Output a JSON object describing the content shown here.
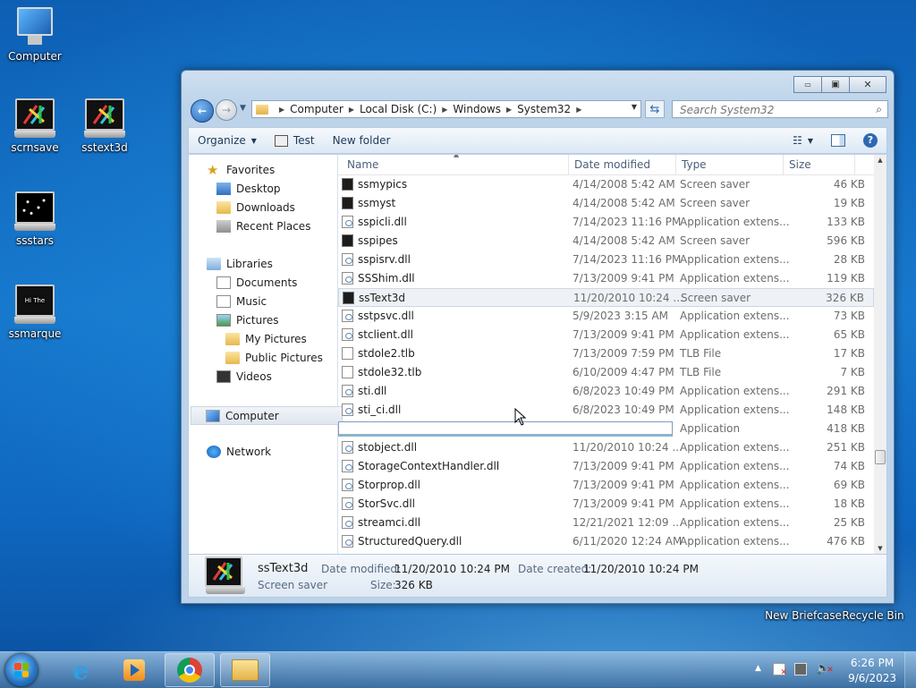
{
  "desktop": {
    "icons": [
      {
        "label": "Computer"
      },
      {
        "label": "scrnsave"
      },
      {
        "label": "sstext3d"
      },
      {
        "label": "ssstars"
      },
      {
        "label": "ssmarque"
      },
      {
        "label": "New Briefcase"
      },
      {
        "label": "Recycle Bin"
      }
    ],
    "marquee_text": "Hi The"
  },
  "window": {
    "caption_buttons": {
      "minimize": "▭",
      "maximize": "▣",
      "close": "✕"
    },
    "address": {
      "crumbs": [
        "Computer",
        "Local Disk (C:)",
        "Windows",
        "System32"
      ]
    },
    "search": {
      "placeholder": "Search System32"
    },
    "toolbar": {
      "organize": "Organize",
      "test": "Test",
      "new_folder": "New folder"
    },
    "nav_pane": {
      "favorites": "Favorites",
      "desktop": "Desktop",
      "downloads": "Downloads",
      "recent_places": "Recent Places",
      "libraries": "Libraries",
      "documents": "Documents",
      "music": "Music",
      "pictures": "Pictures",
      "my_pictures": "My Pictures",
      "public_pictures": "Public Pictures",
      "videos": "Videos",
      "computer": "Computer",
      "network": "Network"
    },
    "columns": {
      "name": "Name",
      "date": "Date modified",
      "type": "Type",
      "size": "Size"
    },
    "files": [
      {
        "name": "ssmypics",
        "date": "4/14/2008 5:42 AM",
        "type": "Screen saver",
        "size": "46 KB",
        "icon": "screensaver"
      },
      {
        "name": "ssmyst",
        "date": "4/14/2008 5:42 AM",
        "type": "Screen saver",
        "size": "19 KB",
        "icon": "screensaver"
      },
      {
        "name": "sspicli.dll",
        "date": "7/14/2023 11:16 PM",
        "type": "Application extens...",
        "size": "133 KB",
        "icon": "dll"
      },
      {
        "name": "sspipes",
        "date": "4/14/2008 5:42 AM",
        "type": "Screen saver",
        "size": "596 KB",
        "icon": "screensaver"
      },
      {
        "name": "sspisrv.dll",
        "date": "7/14/2023 11:16 PM",
        "type": "Application extens...",
        "size": "28 KB",
        "icon": "dll"
      },
      {
        "name": "SSShim.dll",
        "date": "7/13/2009 9:41 PM",
        "type": "Application extens...",
        "size": "119 KB",
        "icon": "dll"
      },
      {
        "name": "ssText3d",
        "date": "11/20/2010 10:24 ...",
        "type": "Screen saver",
        "size": "326 KB",
        "icon": "screensaver"
      },
      {
        "name": "sstpsvc.dll",
        "date": "5/9/2023 3:15 AM",
        "type": "Application extens...",
        "size": "73 KB",
        "icon": "dll"
      },
      {
        "name": "stclient.dll",
        "date": "7/13/2009 9:41 PM",
        "type": "Application extens...",
        "size": "65 KB",
        "icon": "dll"
      },
      {
        "name": "stdole2.tlb",
        "date": "7/13/2009 7:59 PM",
        "type": "TLB File",
        "size": "17 KB",
        "icon": "tlb"
      },
      {
        "name": "stdole32.tlb",
        "date": "6/10/2009 4:47 PM",
        "type": "TLB File",
        "size": "7 KB",
        "icon": "tlb"
      },
      {
        "name": "sti.dll",
        "date": "6/8/2023 10:49 PM",
        "type": "Application extens...",
        "size": "291 KB",
        "icon": "dll"
      },
      {
        "name": "sti_ci.dll",
        "date": "6/8/2023 10:49 PM",
        "type": "Application extens...",
        "size": "148 KB",
        "icon": "dll"
      },
      {
        "name": "",
        "date": "",
        "type": "Application",
        "size": "418 KB",
        "icon": "rename"
      },
      {
        "name": "stobject.dll",
        "date": "11/20/2010 10:24 ...",
        "type": "Application extens...",
        "size": "251 KB",
        "icon": "dll"
      },
      {
        "name": "StorageContextHandler.dll",
        "date": "7/13/2009 9:41 PM",
        "type": "Application extens...",
        "size": "74 KB",
        "icon": "dll"
      },
      {
        "name": "Storprop.dll",
        "date": "7/13/2009 9:41 PM",
        "type": "Application extens...",
        "size": "69 KB",
        "icon": "dll"
      },
      {
        "name": "StorSvc.dll",
        "date": "7/13/2009 9:41 PM",
        "type": "Application extens...",
        "size": "18 KB",
        "icon": "dll"
      },
      {
        "name": "streamci.dll",
        "date": "12/21/2021 12:09 ...",
        "type": "Application extens...",
        "size": "25 KB",
        "icon": "dll"
      },
      {
        "name": "StructuredQuery.dll",
        "date": "6/11/2020 12:24 AM",
        "type": "Application extens...",
        "size": "476 KB",
        "icon": "dll"
      }
    ],
    "details": {
      "name": "ssText3d",
      "type": "Screen saver",
      "date_modified_label": "Date modified:",
      "date_modified": "11/20/2010 10:24 PM",
      "date_created_label": "Date created:",
      "date_created": "11/20/2010 10:24 PM",
      "size_label": "Size:",
      "size": "326 KB"
    }
  },
  "taskbar": {
    "clock_time": "6:26 PM",
    "clock_date": "9/6/2023"
  }
}
